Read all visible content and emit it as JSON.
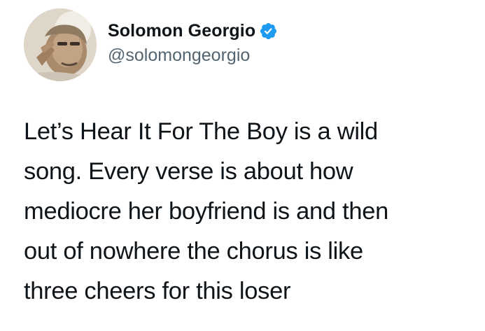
{
  "author": {
    "display_name": "Solomon Georgio",
    "handle": "@solomongeorgio",
    "verified": true,
    "avatar_icon": "avatar-photo"
  },
  "tweet": {
    "lines": [
      "Let’s Hear It For The Boy is a wild",
      "song. Every verse is about how",
      "mediocre her boyfriend is and then",
      "out of nowhere the chorus is like",
      "three cheers for this loser"
    ]
  },
  "colors": {
    "verified": "#1d9bf0",
    "text": "#0f1419",
    "secondary_text": "#536471",
    "background": "#ffffff"
  }
}
